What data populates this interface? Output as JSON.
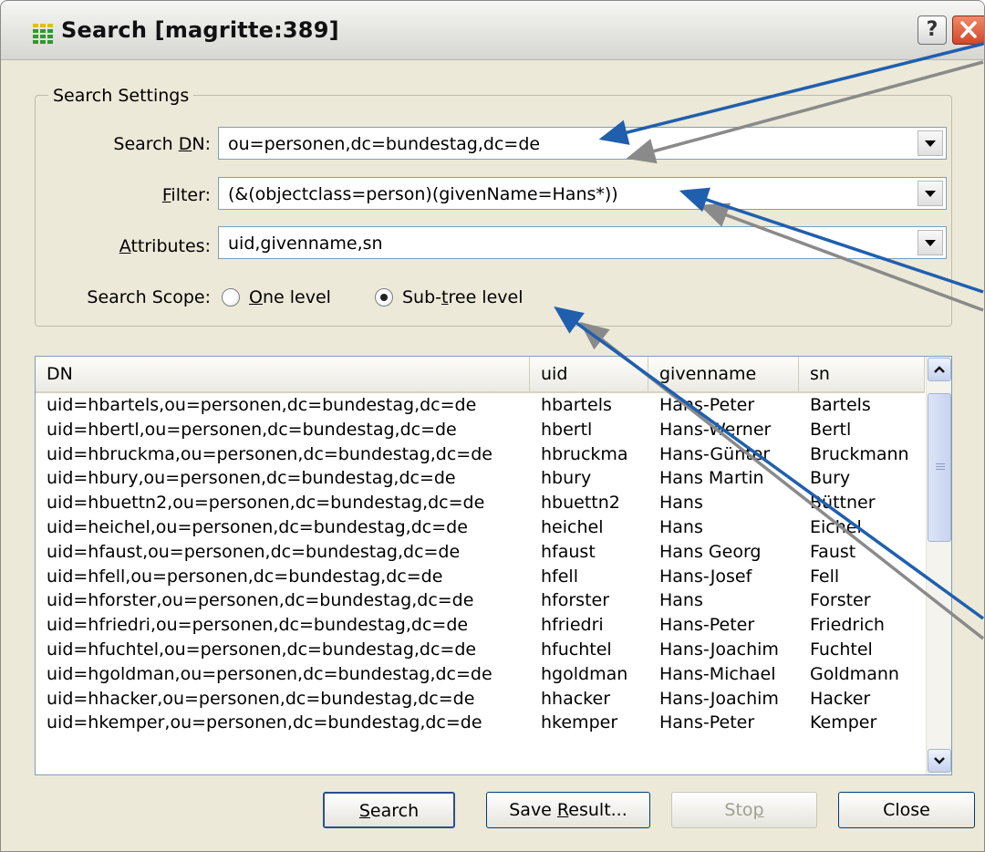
{
  "window": {
    "title": "Search [magritte:389]",
    "help_label": "?"
  },
  "search_settings": {
    "group_title": "Search Settings",
    "search_dn": {
      "label_pre": "Search ",
      "label_key": "D",
      "label_post": "N:",
      "value": "ou=personen,dc=bundestag,dc=de"
    },
    "filter": {
      "label_key": "F",
      "label_post": "ilter:",
      "value": "(&(objectclass=person)(givenName=Hans*))"
    },
    "attributes": {
      "label_key": "A",
      "label_post": "ttributes:",
      "value": "uid,givenname,sn"
    },
    "scope": {
      "label": "Search Scope:",
      "one_level": {
        "key": "O",
        "rest": "ne level",
        "selected": false
      },
      "sub_tree": {
        "pre": "Sub-",
        "key": "t",
        "rest": "ree level",
        "selected": true
      }
    }
  },
  "results": {
    "columns": [
      "DN",
      "uid",
      "givenname",
      "sn"
    ],
    "rows": [
      [
        "uid=hbartels,ou=personen,dc=bundestag,dc=de",
        "hbartels",
        "Hans-Peter",
        "Bartels"
      ],
      [
        "uid=hbertl,ou=personen,dc=bundestag,dc=de",
        "hbertl",
        "Hans-Werner",
        "Bertl"
      ],
      [
        "uid=hbruckma,ou=personen,dc=bundestag,dc=de",
        "hbruckma",
        "Hans-Günter",
        "Bruckmann"
      ],
      [
        "uid=hbury,ou=personen,dc=bundestag,dc=de",
        "hbury",
        "Hans Martin",
        "Bury"
      ],
      [
        "uid=hbuettn2,ou=personen,dc=bundestag,dc=de",
        "hbuettn2",
        "Hans",
        "Büttner"
      ],
      [
        "uid=heichel,ou=personen,dc=bundestag,dc=de",
        "heichel",
        "Hans",
        "Eichel"
      ],
      [
        "uid=hfaust,ou=personen,dc=bundestag,dc=de",
        "hfaust",
        "Hans Georg",
        "Faust"
      ],
      [
        "uid=hfell,ou=personen,dc=bundestag,dc=de",
        "hfell",
        "Hans-Josef",
        "Fell"
      ],
      [
        "uid=hforster,ou=personen,dc=bundestag,dc=de",
        "hforster",
        "Hans",
        "Forster"
      ],
      [
        "uid=hfriedri,ou=personen,dc=bundestag,dc=de",
        "hfriedri",
        "Hans-Peter",
        "Friedrich"
      ],
      [
        "uid=hfuchtel,ou=personen,dc=bundestag,dc=de",
        "hfuchtel",
        "Hans-Joachim",
        "Fuchtel"
      ],
      [
        "uid=hgoldman,ou=personen,dc=bundestag,dc=de",
        "hgoldman",
        "Hans-Michael",
        "Goldmann"
      ],
      [
        "uid=hhacker,ou=personen,dc=bundestag,dc=de",
        "hhacker",
        "Hans-Joachim",
        "Hacker"
      ],
      [
        "uid=hkemper,ou=personen,dc=bundestag,dc=de",
        "hkemper",
        "Hans-Peter",
        "Kemper"
      ]
    ]
  },
  "buttons": {
    "search": {
      "key": "S",
      "rest": "earch"
    },
    "save_result": {
      "pre": "Save ",
      "key": "R",
      "rest": "esult..."
    },
    "stop": {
      "pre": "Sto",
      "key": "p",
      "rest": ""
    },
    "close": "Close"
  },
  "colors": {
    "arrow_blue": "#1f5fae",
    "arrow_gray": "#8a8a8a"
  }
}
